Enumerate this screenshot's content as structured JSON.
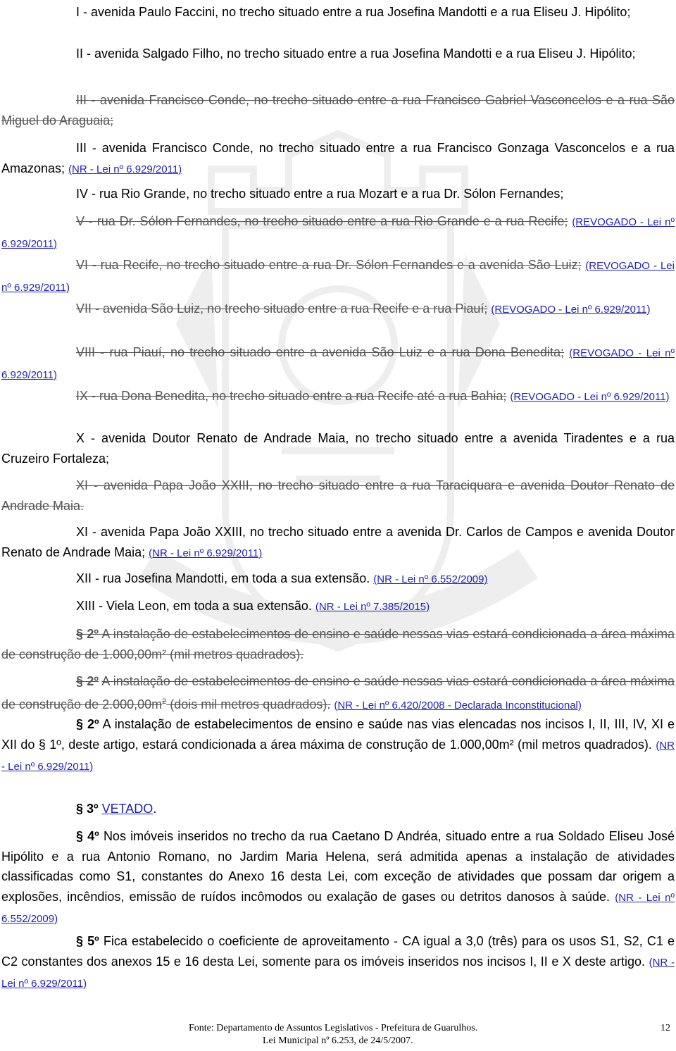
{
  "items": {
    "i_text": "I - avenida Paulo Faccini, no trecho situado entre a rua Josefina Mandotti e a rua Eliseu J. Hipólito;",
    "ii_text": "II - avenida Salgado Filho, no trecho situado entre a rua Josefina Mandotti e a rua Eliseu J. Hipólito;",
    "iii_old_text": "III - avenida Francisco Conde, no trecho situado entre a rua Francisco Gabriel Vasconcelos e a rua São Miguel do Araguaia;",
    "iii_new_text": "III - avenida Francisco Conde, no trecho situado entre a rua Francisco Gonzaga Vasconcelos e a rua Amazonas;",
    "iii_new_ref": "(NR - Lei nº 6.929/2011)",
    "iv_text": "IV - rua Rio Grande, no trecho situado entre a rua Mozart e a rua Dr. Sólon Fernandes;",
    "v_text": "V - rua Dr. Sólon Fernandes, no trecho situado entre a rua Rio Grande e a rua Recife;",
    "v_ref": "(REVOGADO - Lei nº 6.929/2011)",
    "vi_text": "VI - rua Recife, no trecho situado entre a rua Dr. Sólon Fernandes e a avenida São Luiz;",
    "vi_ref": "(REVOGADO - Lei nº 6.929/2011)",
    "vii_text": "VII - avenida São Luiz, no trecho situado entre a rua Recife e a rua Piauí;",
    "vii_ref": "(REVOGADO - Lei nº 6.929/2011)",
    "viii_text": "VIII - rua Piauí, no trecho situado entre a avenida São Luiz e a rua Dona Benedita;",
    "viii_ref": "(REVOGADO - Lei nº 6.929/2011)",
    "ix_text": "IX - rua Dona Benedita, no trecho situado entre a rua Recife até a rua Bahia;",
    "ix_ref": "(REVOGADO - Lei nº 6.929/2011)",
    "x_text": "X - avenida Doutor Renato de Andrade Maia, no trecho situado entre a avenida Tiradentes e a rua Cruzeiro Fortaleza;",
    "xi_old_text": "XI - avenida Papa João XXIII, no trecho situado entre a rua Taraciquara e avenida Doutor Renato de Andrade Maia.",
    "xi_new_text": "XI - avenida Papa João XXIII, no trecho situado entre a avenida  Dr. Carlos de Campos e avenida Doutor Renato de Andrade Maia;",
    "xi_new_ref": "(NR - Lei nº 6.929/2011)",
    "xii_text": "XII - rua Josefina Mandotti, em toda a sua extensão.",
    "xii_ref": "(NR - Lei nº 6.552/2009)",
    "xiii_text": "XIII - Viela Leon, em toda a sua extensão.",
    "xiii_ref": "(NR - Lei nº 7.385/2015)"
  },
  "paragraphs": {
    "p2_old1_mark": "§ 2º",
    "p2_old1_text": "A instalação de estabelecimentos de ensino e saúde nessas vias estará condicionada a área máxima de construção de 1.000,00m² (mil metros quadrados).",
    "p2_old2_mark": "§ 2º",
    "p2_old2_text_a": "A instalação de estabelecimentos de ensino e saúde nessas vias estará condicionada a área máxima de construção de 2.000,00m",
    "p2_old2_sup": "2",
    "p2_old2_text_b": " (dois mil metros quadrados).",
    "p2_old2_ref": "(NR - Lei nº 6.420/2008 - Declarada Inconstitucional)",
    "p2_mark": "§ 2º",
    "p2_text": "A instalação de estabelecimentos de ensino e saúde nas vias elencadas nos incisos I, II, III, IV, XI e XII do § 1º, deste artigo, estará condicionada a área máxima de construção de 1.000,00m² (mil metros quadrados).",
    "p2_ref": "(NR - Lei nº 6.929/2011)",
    "p3_mark": "§ 3º",
    "p3_link": "VETADO",
    "p3_tail": ".",
    "p4_mark": "§ 4º",
    "p4_text": "Nos imóveis inseridos no trecho da rua Caetano D Andréa, situado entre a rua Soldado Eliseu José Hipólito e a rua Antonio Romano, no Jardim Maria Helena, será admitida apenas a instalação de atividades classificadas como S1, constantes do Anexo 16 desta Lei, com exceção de atividades que possam dar origem a explosões, incêndios, emissão de ruídos incômodos ou exalação de gases ou detritos danosos à saúde.",
    "p4_ref": "(NR - Lei nº 6.552/2009)",
    "p5_mark": "§ 5º",
    "p5_text": "Fica estabelecido o coeficiente de aproveitamento - CA igual a 3,0 (três) para os usos S1, S2, C1 e C2 constantes dos anexos 15 e 16 desta Lei, somente para os imóveis inseridos nos incisos I, II e X deste artigo.",
    "p5_ref": "(NR - Lei nº 6.929/2011)"
  },
  "footer": {
    "source": "Fonte: Departamento de Assuntos Legislativos - Prefeitura de Guarulhos.",
    "law": "Lei Municipal nº 6.253, de 24/5/2007.",
    "page_number": "12"
  },
  "watermark": {
    "color": "#3a3a3a",
    "icon": "city-coat-of-arms-watermark"
  }
}
